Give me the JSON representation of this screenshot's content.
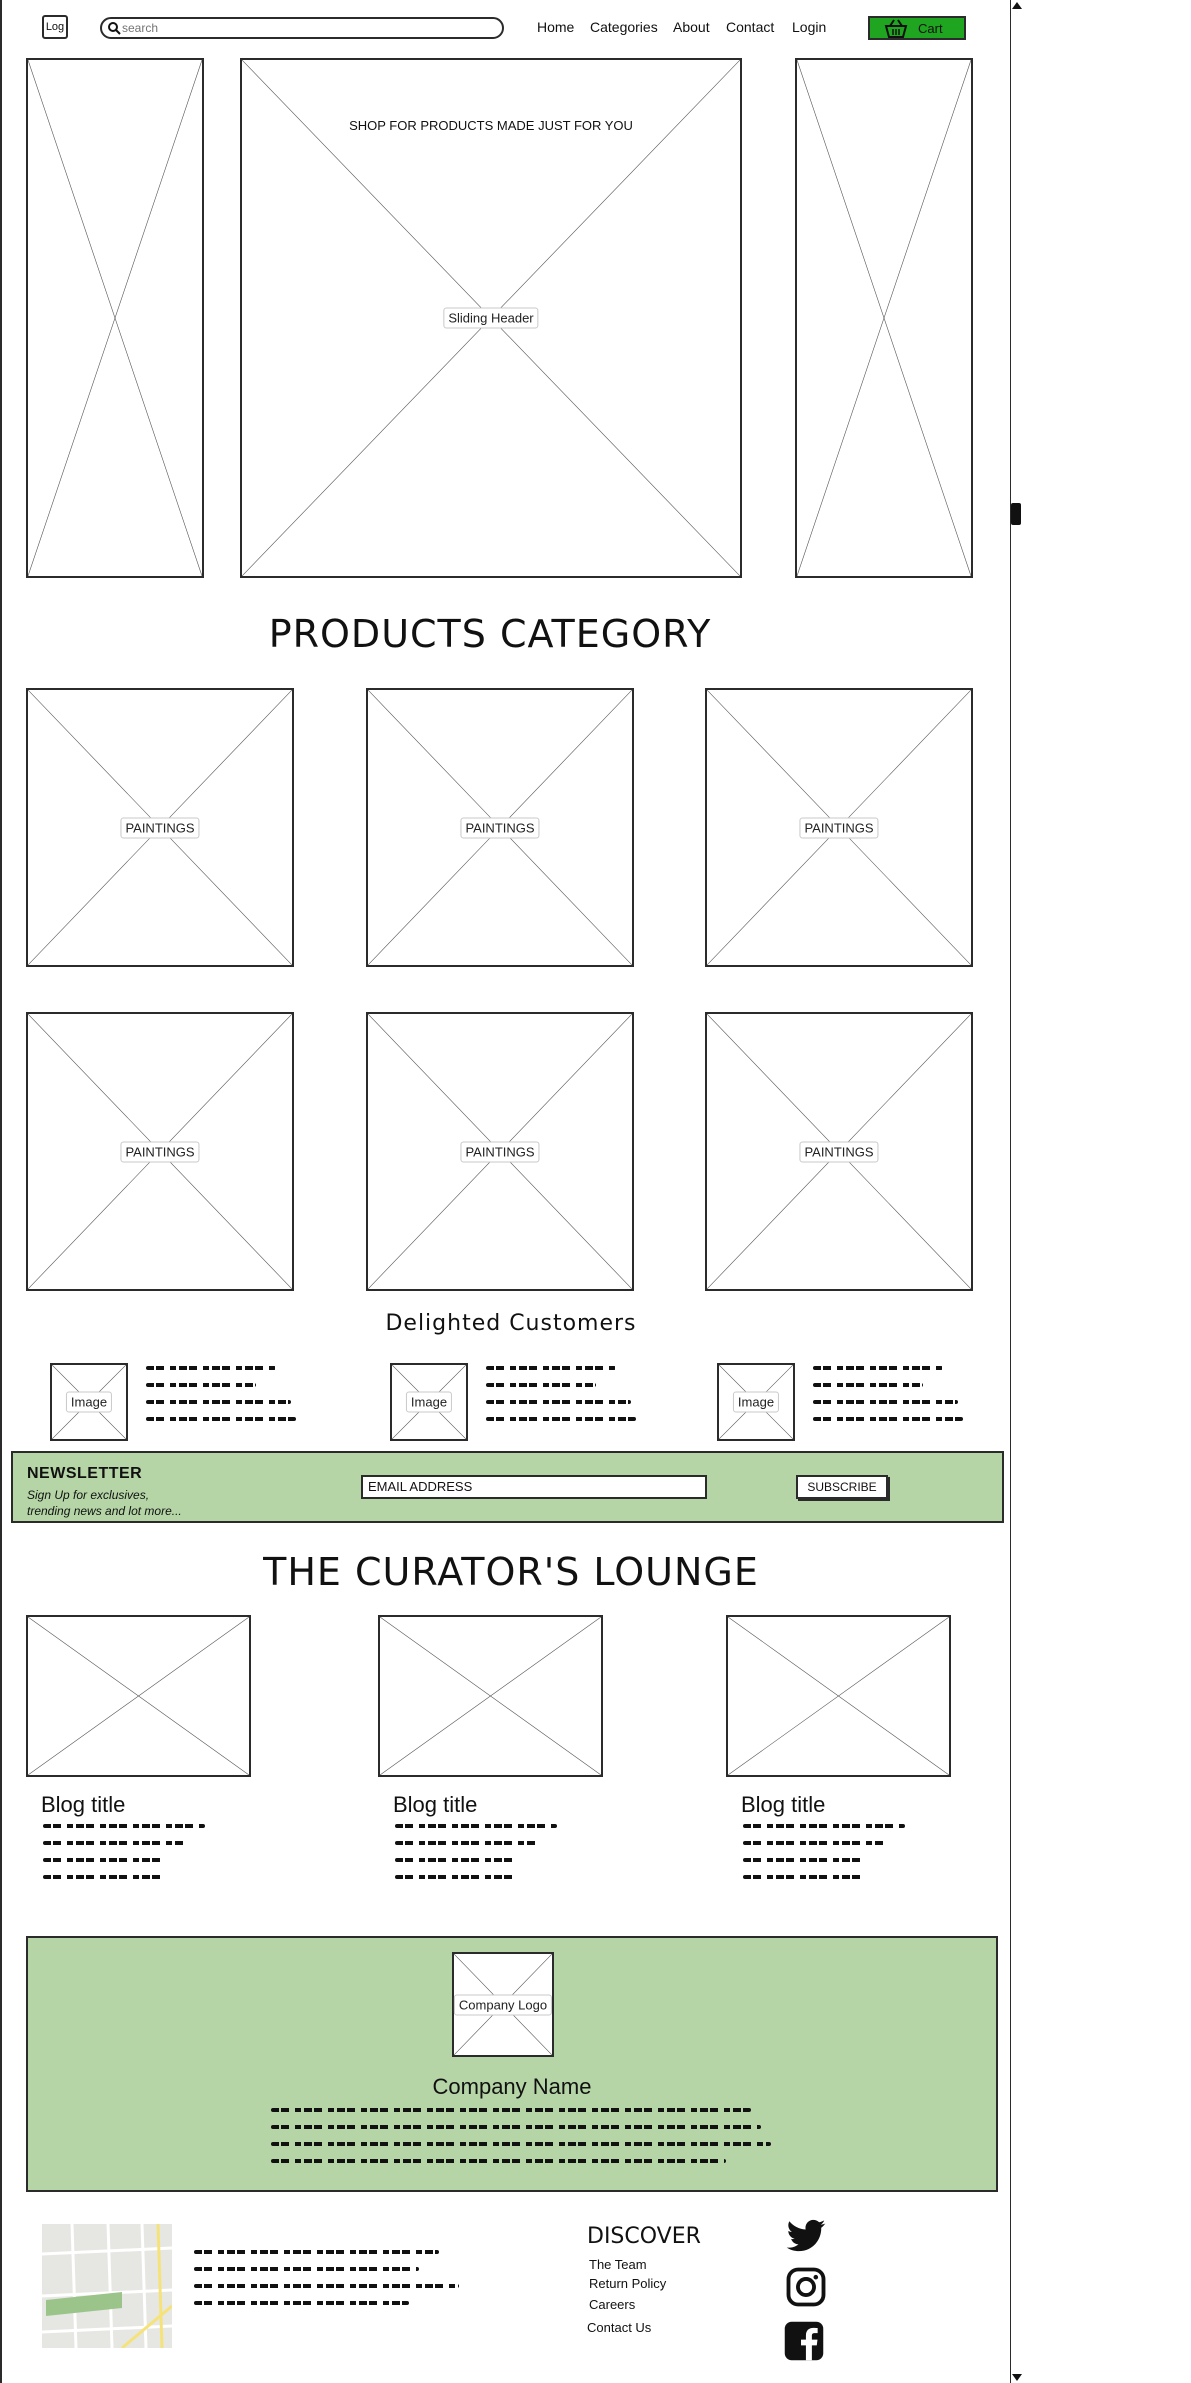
{
  "header": {
    "logo_text": "Log",
    "search_placeholder": "search",
    "nav": [
      "Home",
      "Categories",
      "About",
      "Contact",
      "Login"
    ],
    "cart_label": "Cart"
  },
  "hero": {
    "tagline": "SHOP FOR PRODUCTS MADE JUST FOR YOU",
    "slider_label": "Sliding Header"
  },
  "categories": {
    "title": "PRODUCTS CATEGORY",
    "items": [
      "PAINTINGS",
      "PAINTINGS",
      "PAINTINGS",
      "PAINTINGS",
      "PAINTINGS",
      "PAINTINGS"
    ]
  },
  "testimonials": {
    "title": "Delighted Customers",
    "items": [
      {
        "image_label": "Image"
      },
      {
        "image_label": "Image"
      },
      {
        "image_label": "Image"
      }
    ]
  },
  "newsletter": {
    "title": "NEWSLETTER",
    "subtitle_line1": "Sign Up for exclusives,",
    "subtitle_line2": "trending news and lot more...",
    "email_value": "EMAIL ADDRESS",
    "subscribe_label": "SUBSCRIBE"
  },
  "blog": {
    "title": "THE CURATOR'S LOUNGE",
    "posts": [
      {
        "title": "Blog title"
      },
      {
        "title": "Blog title"
      },
      {
        "title": "Blog title"
      }
    ]
  },
  "company": {
    "logo_label": "Company Logo",
    "name": "Company Name"
  },
  "footer": {
    "discover_title": "DISCOVER",
    "links": [
      "The Team",
      "Return Policy",
      "Careers",
      "Contact Us"
    ],
    "social_icons": [
      "twitter-icon",
      "instagram-icon",
      "facebook-icon"
    ]
  },
  "colors": {
    "accent_green": "#b5d5a7",
    "cart_green": "#1fa51f",
    "border": "#2b2b2b"
  }
}
